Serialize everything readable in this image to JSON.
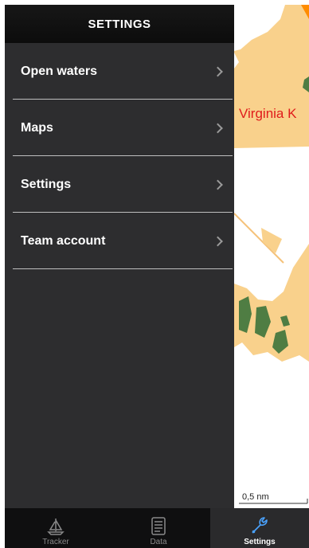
{
  "sidebar": {
    "title": "SETTINGS",
    "items": [
      {
        "label": "Open waters"
      },
      {
        "label": "Maps"
      },
      {
        "label": "Settings"
      },
      {
        "label": "Team account"
      }
    ]
  },
  "map": {
    "place_label": "Virginia K",
    "scale_label": "0,5 nm"
  },
  "tabbar": {
    "tabs": [
      {
        "label": "Tracker",
        "icon": "sailboat-icon"
      },
      {
        "label": "Data",
        "icon": "document-icon"
      },
      {
        "label": "Settings",
        "icon": "wrench-icon",
        "active": true
      }
    ]
  },
  "colors": {
    "land": "#f9d18c",
    "water": "#ffffff",
    "vegetation": "#4f7d43",
    "sidebar": "#2d2d2f",
    "label_red": "#e01b1b"
  }
}
